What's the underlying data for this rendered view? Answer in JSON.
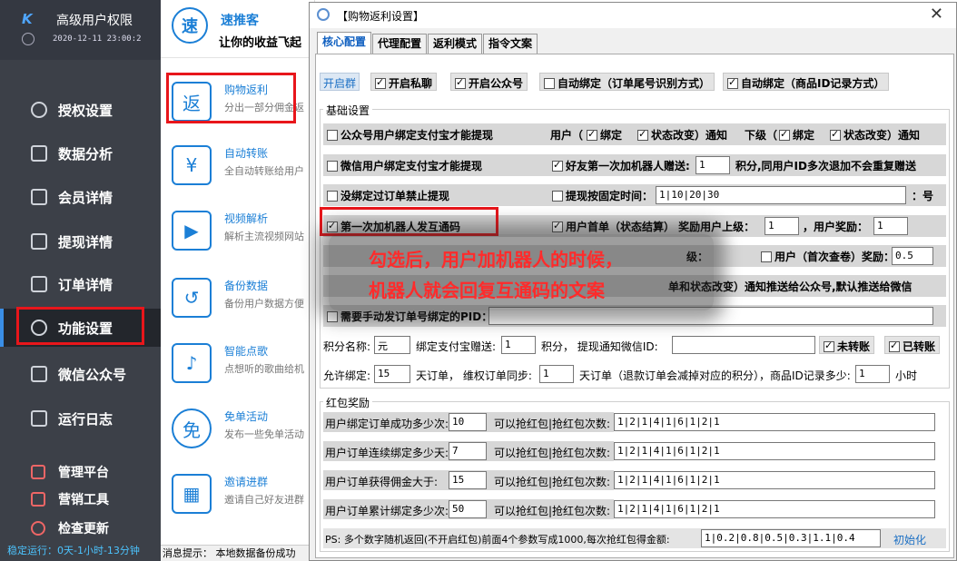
{
  "sidebar": {
    "logo": "K",
    "title": "高级用户权限",
    "datetime": "2020-12-11 23:00:2",
    "items": [
      {
        "label": "授权设置",
        "icon": "globe-icon"
      },
      {
        "label": "数据分析",
        "icon": "chart-icon"
      },
      {
        "label": "会员详情",
        "icon": "external-link-icon"
      },
      {
        "label": "提现详情",
        "icon": "search-doc-icon"
      },
      {
        "label": "订单详情",
        "icon": "yen-doc-icon"
      },
      {
        "label": "功能设置",
        "icon": "chat-gear-icon",
        "active": true
      },
      {
        "label": "微信公众号",
        "icon": "wechat-icon"
      },
      {
        "label": "运行日志",
        "icon": "speaker-icon"
      },
      {
        "label": "管理平台",
        "icon": "stack-icon"
      },
      {
        "label": "营销工具",
        "icon": "grid-icon"
      },
      {
        "label": "检查更新",
        "icon": "refresh-icon"
      }
    ],
    "status": "稳定运行：0天-1小时-13分钟"
  },
  "middle": {
    "brand_icon": "速",
    "brand_name": "速推客",
    "slogan": "让你的收益飞起",
    "features": [
      {
        "title": "购物返利",
        "desc": "分出一部分佣金返",
        "icon": "返"
      },
      {
        "title": "自动转账",
        "desc": "全自动转账给用户",
        "icon": "¥"
      },
      {
        "title": "视频解析",
        "desc": "解析主流视频网站",
        "icon": "▶"
      },
      {
        "title": "备份数据",
        "desc": "备份用户数据方便",
        "icon": "↺"
      },
      {
        "title": "智能点歌",
        "desc": "点想听的歌曲给机",
        "icon": "♪"
      },
      {
        "title": "免单活动",
        "desc": "发布一些免单活动",
        "icon": "免"
      },
      {
        "title": "邀请进群",
        "desc": "邀请自己好友进群",
        "icon": "▦"
      }
    ],
    "footer": "消息提示：  本地数据备份成功"
  },
  "dialog": {
    "title": "【购物返利设置】",
    "close": "✕",
    "tabs": [
      "核心配置",
      "代理配置",
      "返利模式",
      "指令文案"
    ],
    "top_row": {
      "group_btn": "开启群",
      "private": "开启私聊",
      "official": "开启公众号",
      "auto_order": "自动绑定（订单尾号识别方式）",
      "auto_goods": "自动绑定（商品ID记录方式）"
    },
    "basic_legend": "基础设置",
    "rows": {
      "r1_label": "公众号用户绑定支付宝才能提现",
      "r1_user": "用户（",
      "r1_bind": "绑定",
      "r1_status": "状态改变）通知",
      "r1_lower": "下级（",
      "r1_bind2": "绑定",
      "r1_status2": "状态改变）通知",
      "r2_label": "微信用户绑定支付宝才能提现",
      "r2_friend": "好友第一次加机器人赠送:",
      "r2_value": "1",
      "r2_tail": "积分,同用户ID多次退加不会重复赠送",
      "r3_label": "没绑定过订单禁止提现",
      "r3_fixed": "提现按固定时间：",
      "r3_value": "1|10|20|30",
      "r3_tail": "：号",
      "r4_label": "第一次加机器人发互通码",
      "r4_first": "用户首单（状态结算） 奖励用户上级：",
      "r4_value1": "1",
      "r4_user_reward": "，用户奖励：",
      "r4_value2": "1",
      "r5_level": "级：",
      "r5_first_check": "用户（首次查卷）奖励：",
      "r5_value": "0.5",
      "r6_tail": "单和状态改变）通知推送给公众号,默认推送给微信",
      "r7_label": "需要手动发订单号绑定的PID：",
      "r8_points_name": "积分名称:",
      "r8_points_value": "元",
      "r8_alipay": "绑定支付宝赠送:",
      "r8_alipay_value": "1",
      "r8_notify": "积分， 提现通知微信ID:",
      "r8_notify_value": "",
      "r8_unsettled": "未转账",
      "r8_settled": "已转账",
      "r9_allow": "允许绑定:",
      "r9_allow_value": "15",
      "r9_days": "天订单， 维权订单同步:",
      "r9_sync_value": "1",
      "r9_tail": "天订单（退款订单会减掉对应的积分），商品ID记录多少:",
      "r9_goods_value": "1",
      "r9_hour": "小时"
    },
    "redpack_legend": "红包奖励",
    "redpack": [
      {
        "label": "用户绑定订单成功多少次:",
        "value": "10",
        "mid": "可以抢红包|抢红包次数:",
        "times": "1|2|1|4|1|6|1|2|1"
      },
      {
        "label": "用户订单连续绑定多少天:",
        "value": "7",
        "mid": "可以抢红包|抢红包次数:",
        "times": "1|2|1|4|1|6|1|2|1"
      },
      {
        "label": "用户订单获得佣金大于:",
        "value": "15",
        "mid": "可以抢红包|抢红包次数:",
        "times": "1|2|1|4|1|6|1|2|1"
      },
      {
        "label": "用户订单累计绑定多少次:",
        "value": "50",
        "mid": "可以抢红包|抢红包次数:",
        "times": "1|2|1|4|1|6|1|2|1"
      }
    ],
    "ps_label": "PS: 多个数字随机返回(不开启红包)前面4个参数写成1000,每次抢红包得金额:",
    "ps_value": "1|0.2|0.8|0.5|0.3|1.1|0.4",
    "init": "初始化"
  },
  "annotation": {
    "line1": "勾选后，用户加机器人的时候，",
    "line2": "机器人就会回复互通码的文案"
  },
  "colors": {
    "sidebar_bg": "#3c4048",
    "accent": "#1b7fd6",
    "highlight": "#e8161b"
  }
}
